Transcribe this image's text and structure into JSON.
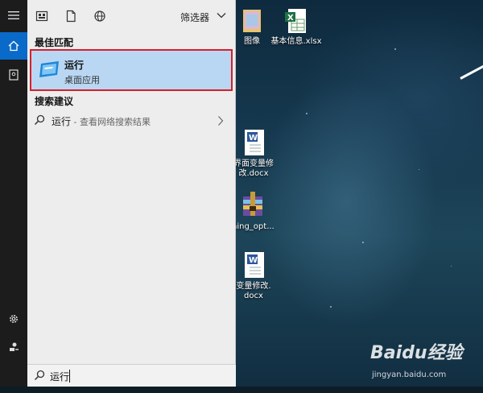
{
  "start_menu": {
    "toolbar": {
      "filter_label": "筛选器"
    },
    "best_match": {
      "heading": "最佳匹配",
      "title": "运行",
      "subtitle": "桌面应用"
    },
    "suggestions": {
      "heading": "搜索建议",
      "items": [
        {
          "term": "运行",
          "desc": " - 查看网络搜索结果"
        }
      ]
    },
    "search": {
      "value": "运行"
    }
  },
  "desktop": {
    "icons": [
      {
        "label": "图像"
      },
      {
        "label": "基本信息.xlsx"
      },
      {
        "label": "界面变量修改.docx",
        "line1": "界面变量修",
        "line2": "改.docx"
      },
      {
        "label": "ning_opt...",
        "line1": "ning_opt..."
      },
      {
        "label": "变量修改.docx",
        "line1": "变量修改.",
        "line2": "docx"
      }
    ]
  },
  "watermark": {
    "logo": "Baidu经验",
    "url": "jingyan.baidu.com"
  },
  "colors": {
    "accent": "#0a6ac9",
    "selection": "#b9d7f3",
    "highlight_border": "#d61f2c"
  }
}
